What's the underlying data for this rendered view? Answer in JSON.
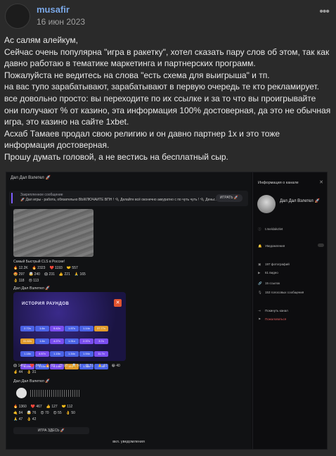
{
  "post": {
    "author": "musafir",
    "date": "16 июн 2023",
    "more_glyph": "•••",
    "paragraphs": [
      "Ас салям алейкум,",
      "Сейчас очень популярна \"игра в ракетку\", хотел сказать пару слов об этом, так как давно работаю в тематике маркетинга и партнерских программ.",
      "Пожалуйста не ведитесь на слова \"есть схема для выигрыша\" и тп.",
      "на вас тупо зарабатывают, зарабатывают в первую очередь те кто рекламирует.",
      "все довольно просто: вы переходите по их ссылке и за то что вы проигрывайте они получают % от казино, эта информация 100% достоверная, да это не обычная игра, это казино на сайте 1xbet.",
      "Асхаб Тамаев продал свою религию и он давно партнер 1x и это тоже информация достоверная.",
      "Прошу думать головой, а не вестись на бесплатный сыр."
    ]
  },
  "screenshot": {
    "chat_title": "Дал Дал Взлетел 🚀",
    "pinned_title": "Закрепленное сообщение",
    "pinned_text": "🚀 Дал игры - работа, обязательно ВЫКЛЮЧАЙТЕ ВПН ! 🔌 Делайте всё оконечно аккуратно с по чуть чуть ! 🔌 Деньг...",
    "pinned_button": "ИГРАТЬ 🚀",
    "road_caption": "Самый Быстрый CLS в России!",
    "reacts_row1": [
      "🔥 12.2K",
      "🔥 2323",
      "❤️ 1193",
      "🤝 557"
    ],
    "reacts_row2": [
      "🤩 297",
      "🤯 240",
      "😱 231",
      "👍 221",
      "🙏 165"
    ],
    "reacts_row3": [
      "👌 118",
      "😢 113"
    ],
    "sender_2": "Дал Дал Взлетел 🚀",
    "rounds_title": "ИСТОРИЯ РАУНДОВ",
    "rounds_close": "✕",
    "round_values": [
      "2.72x",
      "1.6x",
      "5.42x",
      "1.97x",
      "1.14x",
      "37.77x",
      "31.62x",
      "1.6x",
      "4.27x",
      "1.31x",
      "2.37x",
      "3.7x",
      "1.18x",
      "4.57x",
      "1.15x",
      "1.34x",
      "1.94x",
      "11.7x",
      "8.19x",
      "1.15x",
      "2.14x",
      "15.2x",
      "1.36x",
      "1.64x"
    ],
    "round_colors": [
      "#4b63e6",
      "#4b63e6",
      "#7a4ef0",
      "#4b63e6",
      "#4b63e6",
      "#e09a2a",
      "#e09a2a",
      "#4b63e6",
      "#7a4ef0",
      "#4b63e6",
      "#7a4ef0",
      "#7a4ef0",
      "#4b63e6",
      "#7a4ef0",
      "#4b63e6",
      "#4b63e6",
      "#4b63e6",
      "#7a4ef0",
      "#7a4ef0",
      "#4b63e6",
      "#7a4ef0",
      "#e09a2a",
      "#4b63e6",
      "#4b63e6"
    ],
    "reacts_row4": [
      "😱 1467",
      "❤️ 244",
      "🔥 93",
      "😍 98",
      "🤯 60",
      "😢 51",
      "🙏 41",
      "😁 40"
    ],
    "reacts_row5": [
      "🤞 44",
      "👌 31"
    ],
    "sender_3": "Дал Дал Взлетел 🚀",
    "reacts_row6": [
      "🔥 1360",
      "❤️ 467",
      "👍 127",
      "🤝 112"
    ],
    "reacts_row7": [
      "🤙 84",
      "🤯 76",
      "😍 70",
      "😍 55",
      "👌 50"
    ],
    "reacts_row8": [
      "🙏 47",
      "👌 42"
    ],
    "play_here": "ИГРА ЗДЕСЬ 🚀",
    "footer": "вкл. уведомления",
    "info_title": "Информация о канале",
    "info_close": "✕",
    "info_name": "Дал Дал Взлетел 🚀",
    "info_rows": [
      {
        "icon": "ⓘ",
        "text": "t.me/dalvzlet"
      },
      {
        "icon": "🔔",
        "text": "Уведомления"
      },
      {
        "icon": "▣",
        "text": "197 фотографий"
      },
      {
        "icon": "▶",
        "text": "61 видео"
      },
      {
        "icon": "🔗",
        "text": "15 ссылок"
      },
      {
        "icon": "🎙",
        "text": "153 голосовых сообщения"
      },
      {
        "icon": "⇥",
        "text": "Покинуть канал"
      },
      {
        "icon": "⚑",
        "text": "Пожаловаться"
      }
    ]
  }
}
